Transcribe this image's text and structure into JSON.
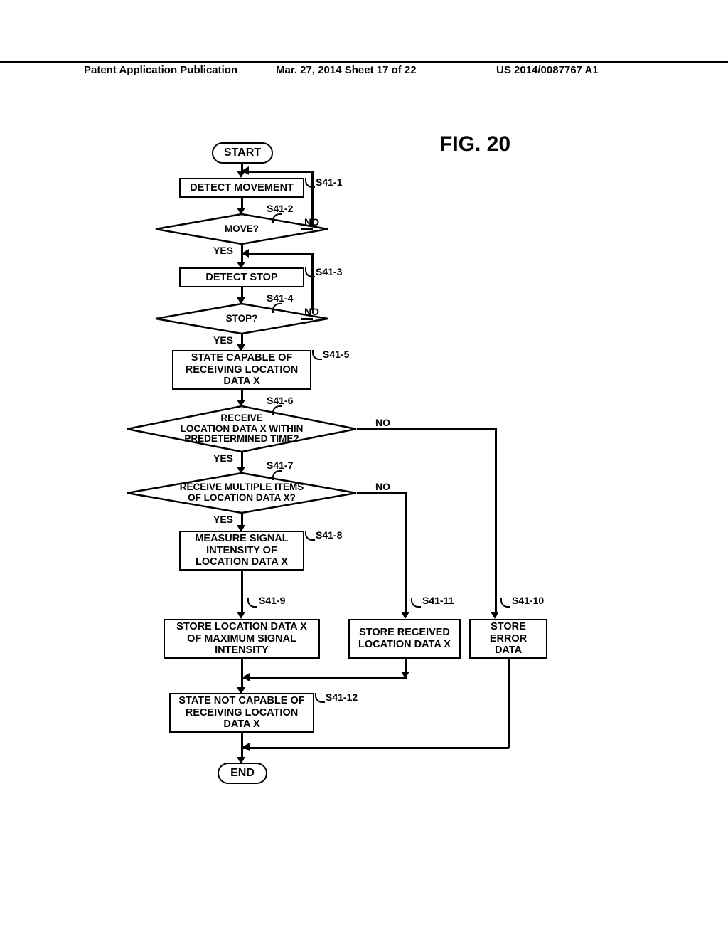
{
  "header": {
    "left": "Patent Application Publication",
    "middle": "Mar. 27, 2014  Sheet 17 of 22",
    "right": "US 2014/0087767 A1"
  },
  "figure_title": "FIG. 20",
  "terminator_start": "START",
  "terminator_end": "END",
  "steps": {
    "s1": {
      "ref": "S41-1",
      "text": "DETECT MOVEMENT"
    },
    "s2": {
      "ref": "S41-2",
      "text": "MOVE?"
    },
    "s3": {
      "ref": "S41-3",
      "text": "DETECT STOP"
    },
    "s4": {
      "ref": "S41-4",
      "text": "STOP?"
    },
    "s5": {
      "ref": "S41-5",
      "text": "STATE CAPABLE OF\nRECEIVING LOCATION\nDATA X"
    },
    "s6": {
      "ref": "S41-6",
      "text": "RECEIVE\nLOCATION DATA X WITHIN\nPREDETERMINED TIME?"
    },
    "s7": {
      "ref": "S41-7",
      "text": "RECEIVE MULTIPLE ITEMS\nOF LOCATION DATA X?"
    },
    "s8": {
      "ref": "S41-8",
      "text": "MEASURE SIGNAL\nINTENSITY OF\nLOCATION DATA X"
    },
    "s9": {
      "ref": "S41-9",
      "text": "STORE LOCATION DATA X\nOF MAXIMUM SIGNAL\nINTENSITY"
    },
    "s10": {
      "ref": "S41-10",
      "text": "STORE\nERROR DATA"
    },
    "s11": {
      "ref": "S41-11",
      "text": "STORE RECEIVED\nLOCATION DATA X"
    },
    "s12": {
      "ref": "S41-12",
      "text": "STATE NOT CAPABLE OF\nRECEIVING LOCATION\nDATA X"
    }
  },
  "labels": {
    "yes": "YES",
    "no": "NO"
  }
}
